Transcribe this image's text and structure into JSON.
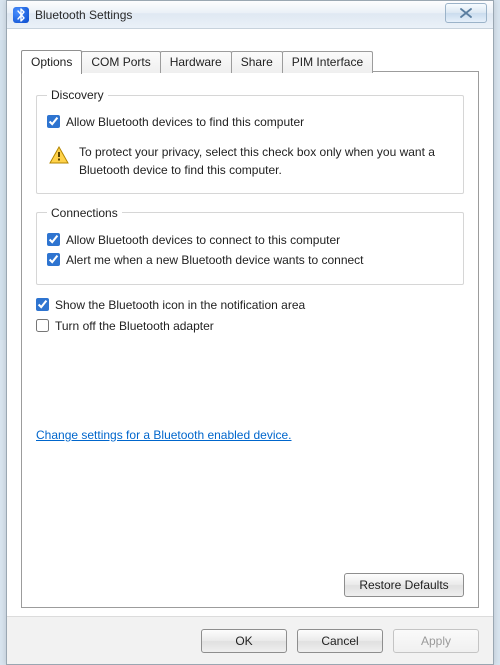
{
  "window": {
    "title": "Bluetooth Settings",
    "icon": "bluetooth-icon",
    "close_label": "Close"
  },
  "tabs": [
    {
      "label": "Options",
      "active": true
    },
    {
      "label": "COM Ports",
      "active": false
    },
    {
      "label": "Hardware",
      "active": false
    },
    {
      "label": "Share",
      "active": false
    },
    {
      "label": "PIM Interface",
      "active": false
    }
  ],
  "options": {
    "discovery": {
      "legend": "Discovery",
      "allow_find": {
        "label": "Allow Bluetooth devices to find this computer",
        "checked": true
      },
      "info_icon": "warning-icon",
      "info_text": "To protect your privacy, select this check box only when you want a Bluetooth device to find this computer."
    },
    "connections": {
      "legend": "Connections",
      "allow_connect": {
        "label": "Allow Bluetooth devices to connect to this computer",
        "checked": true
      },
      "alert_new": {
        "label": "Alert me when a new Bluetooth device wants to connect",
        "checked": true
      }
    },
    "show_tray_icon": {
      "label": "Show the Bluetooth icon in the notification area",
      "checked": true
    },
    "turn_off_adapter": {
      "label": "Turn off the Bluetooth adapter",
      "checked": false
    },
    "change_settings_link": "Change settings for a Bluetooth enabled device.",
    "restore_defaults_label": "Restore Defaults"
  },
  "buttons": {
    "ok": "OK",
    "cancel": "Cancel",
    "apply": "Apply",
    "apply_enabled": false
  }
}
